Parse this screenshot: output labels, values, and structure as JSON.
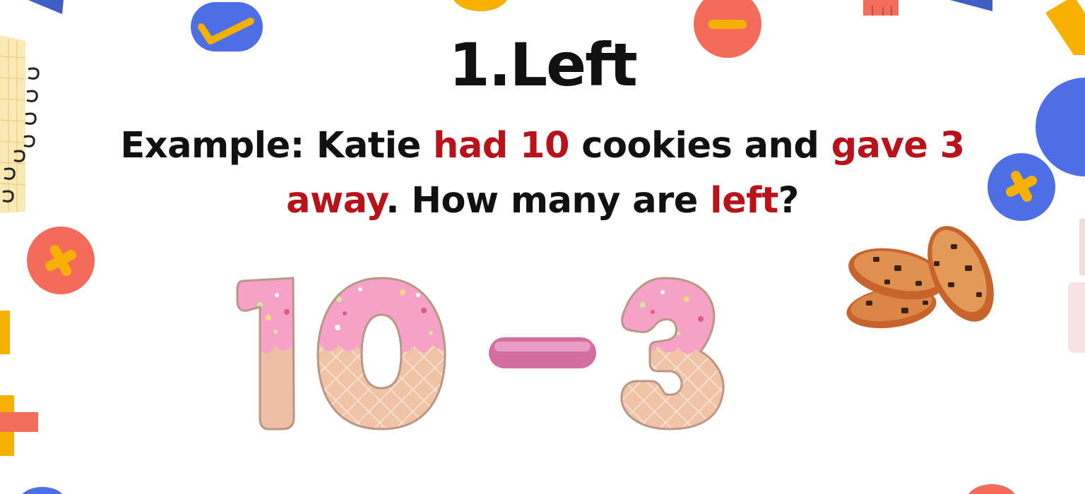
{
  "slide": {
    "title": "1.Left",
    "sentence": [
      {
        "text": "Example: Katie ",
        "highlight": false
      },
      {
        "text": "had 10",
        "highlight": true
      },
      {
        "text": " cookies and ",
        "highlight": false
      },
      {
        "text": "gave 3 away",
        "highlight": true
      },
      {
        "text": ". How many are ",
        "highlight": false
      },
      {
        "text": "left",
        "highlight": true
      },
      {
        "text": "?",
        "highlight": false
      }
    ],
    "equation": {
      "minuend": "10",
      "operator": "-",
      "subtrahend": "3"
    },
    "colors": {
      "text": "#111111",
      "highlight": "#b8121a",
      "frosting": "#f5a2c6",
      "wafer": "#f0c2a6",
      "minus": "#d46da0"
    }
  },
  "decorations": [
    "check-icon",
    "minus-icon",
    "plus-icon",
    "plus-icon",
    "notebook-icon",
    "cookies-image",
    "ruler-icon"
  ]
}
